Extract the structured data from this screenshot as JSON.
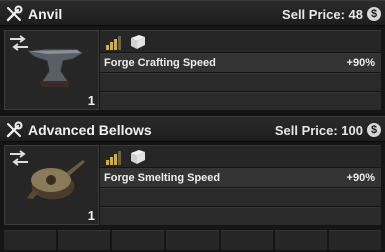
{
  "items": [
    {
      "title": "Anvil",
      "sell_price": "Sell Price: 48",
      "coin_icon": "coin-icon",
      "image_icon": "anvil-icon",
      "quantity": "1",
      "stat_label": "Forge Crafting Speed",
      "stat_value": "+90%"
    },
    {
      "title": "Advanced Bellows",
      "sell_price": "Sell Price: 100",
      "coin_icon": "coin-icon",
      "image_icon": "bellows-icon",
      "quantity": "1",
      "stat_label": "Forge Smelting Speed",
      "stat_value": "+90%"
    }
  ],
  "coin_glyph": "$",
  "colors": {
    "background": "#151515",
    "header": "#2b2b2b",
    "text": "#e8e8e8",
    "tier": "#c9b04a"
  }
}
